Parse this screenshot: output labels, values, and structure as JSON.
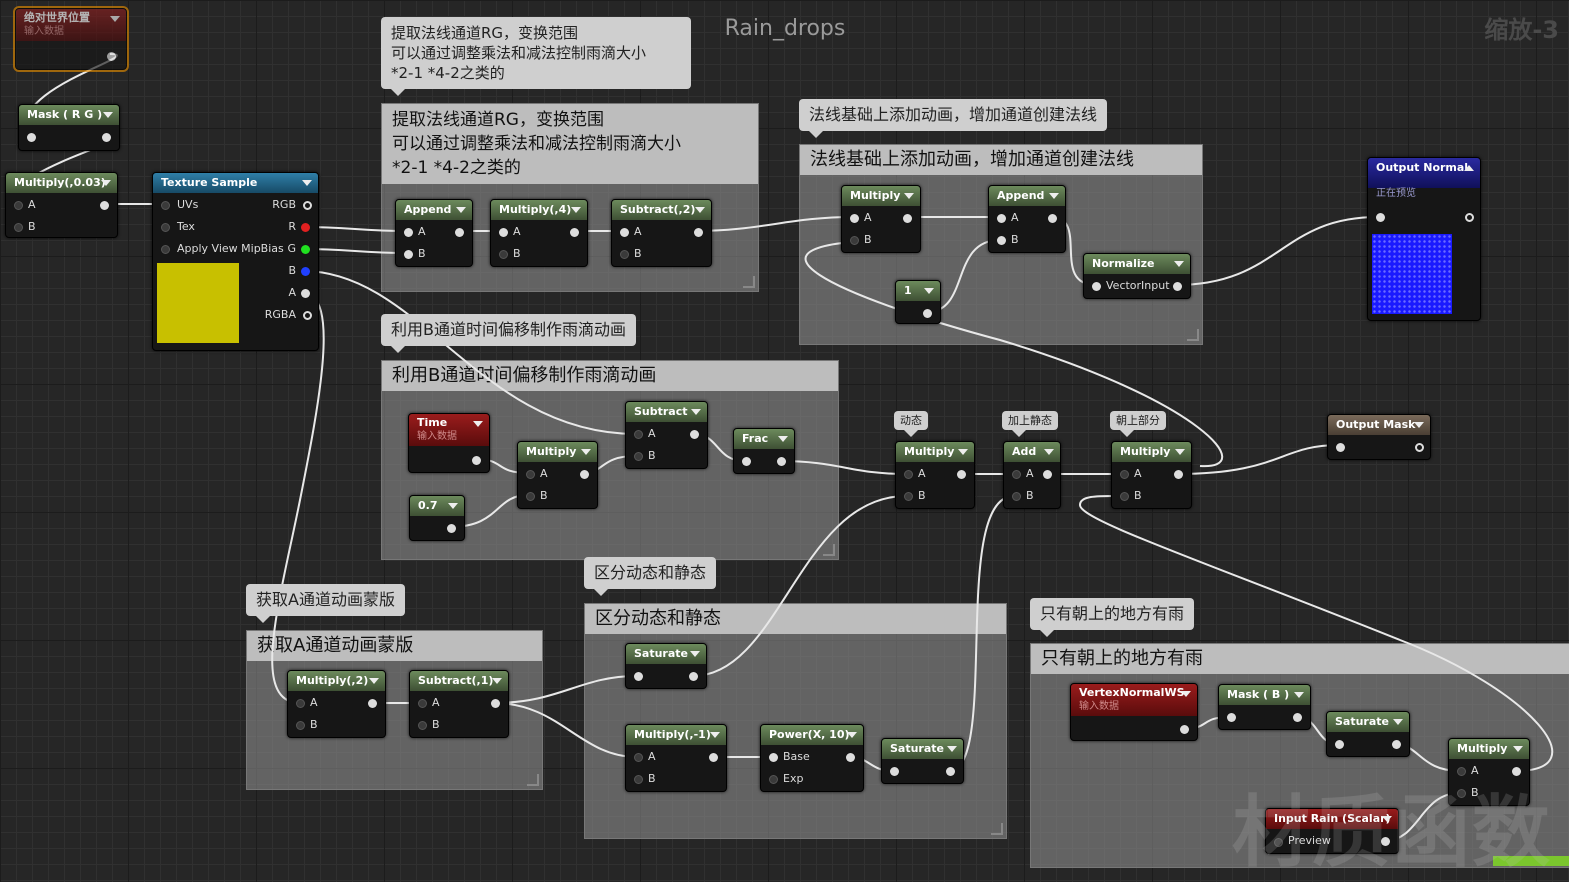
{
  "graph_title": "Rain_drops",
  "zoom_label": "缩放-3",
  "watermark": "材质函数",
  "comments": {
    "rg": {
      "bubble": "提取法线通道RG，变换范围\n可以通过调整乘法和减法控制雨滴大小\n*2-1 *4-2之类的",
      "title": "提取法线通道RG，变换范围\n可以通过调整乘法和减法控制雨滴大小\n*2-1 *4-2之类的"
    },
    "anim": {
      "bubble": "法线基础上添加动画，增加通道创建法线",
      "title": "法线基础上添加动画，增加通道创建法线"
    },
    "b": {
      "bubble": "利用B通道时间偏移制作雨滴动画",
      "title": "利用B通道时间偏移制作雨滴动画"
    },
    "a": {
      "bubble": "获取A通道动画蒙版",
      "title": "获取A通道动画蒙版"
    },
    "dyn": {
      "bubble": "区分动态和静态",
      "title": "区分动态和静态"
    },
    "up": {
      "bubble": "只有朝上的地方有雨",
      "title": "只有朝上的地方有雨"
    }
  },
  "small_notes": {
    "dynamic": "动态",
    "add_static": "加上静态",
    "up_part": "朝上部分"
  },
  "pins": {
    "a": "A",
    "b": "B",
    "uvs": "UVs",
    "tex": "Tex",
    "mip": "Apply View MipBias",
    "rgb": "RGB",
    "r": "R",
    "g": "G",
    "bch": "B",
    "ach": "A",
    "rgba": "RGBA",
    "vector_input": "VectorInput",
    "base": "Base",
    "exp": "Exp",
    "preview": "Preview"
  },
  "nodes": {
    "world_pos": {
      "title": "绝对世界位置",
      "sub": "输入数据"
    },
    "mask_rg": {
      "title": "Mask ( R G )"
    },
    "mult_003": {
      "title": "Multiply(,0.03)"
    },
    "tex_sample": {
      "title": "Texture Sample"
    },
    "append1": {
      "title": "Append"
    },
    "mult4": {
      "title": "Multiply(,4)"
    },
    "sub2": {
      "title": "Subtract(,2)"
    },
    "multiply1": {
      "title": "Multiply"
    },
    "append2": {
      "title": "Append"
    },
    "normalize": {
      "title": "Normalize"
    },
    "const1": {
      "title": "1"
    },
    "output_normal": {
      "title": "Output Normal",
      "sub": "正在预览"
    },
    "time": {
      "title": "Time",
      "sub": "输入数据"
    },
    "const07": {
      "title": "0.7"
    },
    "multiply2": {
      "title": "Multiply"
    },
    "subtract1": {
      "title": "Subtract"
    },
    "frac": {
      "title": "Frac"
    },
    "multiply3": {
      "title": "Multiply"
    },
    "add": {
      "title": "Add"
    },
    "multiply4": {
      "title": "Multiply"
    },
    "output_mask": {
      "title": "Output Mask"
    },
    "mult2": {
      "title": "Multiply(,2)"
    },
    "sub1": {
      "title": "Subtract(,1)"
    },
    "saturate1": {
      "title": "Saturate"
    },
    "mult_neg1": {
      "title": "Multiply(,-1)"
    },
    "power": {
      "title": "Power(X, 10)"
    },
    "saturate2": {
      "title": "Saturate"
    },
    "vertex_normal": {
      "title": "VertexNormalWS",
      "sub": "输入数据"
    },
    "mask_b": {
      "title": "Mask ( B )"
    },
    "saturate3": {
      "title": "Saturate"
    },
    "multiply5": {
      "title": "Multiply"
    },
    "input_rain": {
      "title": "Input Rain (Scalar)"
    }
  },
  "colors": {
    "bg": "#262626",
    "comment_title": "#bdbdbd",
    "node_green": "#4e6a42",
    "node_blue": "#2f7fa8",
    "node_red": "#8a1818",
    "node_navy": "#1e1e8a",
    "preview_yellow": "#c8c000",
    "preview_blue": "#1a1aff"
  }
}
